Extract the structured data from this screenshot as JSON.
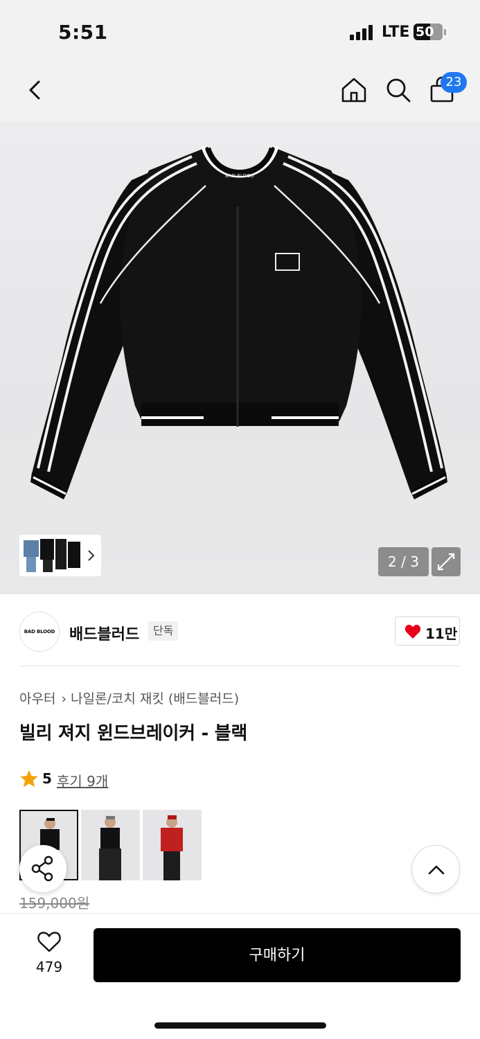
{
  "status_bar": {
    "time": "5:51",
    "network": "LTE",
    "battery": "50"
  },
  "nav": {
    "back_icon": "chevron-left-icon",
    "home_icon": "home-icon",
    "search_icon": "search-icon",
    "cart_icon": "shopping-bag-icon",
    "cart_count": "23"
  },
  "gallery": {
    "counter": "2 / 3",
    "expand_icon": "expand-icon",
    "thumbnail_more_icon": "chevron-right-icon"
  },
  "brand": {
    "logo_text": "BAD BLOOD",
    "name": "배드블러드",
    "tag": "단독",
    "likes": "11만"
  },
  "product": {
    "breadcrumb": [
      "아우터",
      "나일론/코치 재킷 (배드블러드)"
    ],
    "title": "빌리 져지 윈드브레이커 - 블랙",
    "rating": "5",
    "reviews_label": "후기 9개",
    "original_price": "159,000원"
  },
  "colors": {
    "accent": "#1f78f0",
    "heart": "#e8001c",
    "star": "#f5a20a",
    "buy_button": "#000000"
  },
  "bottom_bar": {
    "wishlist_count": "479",
    "buy_label": "구매하기"
  }
}
